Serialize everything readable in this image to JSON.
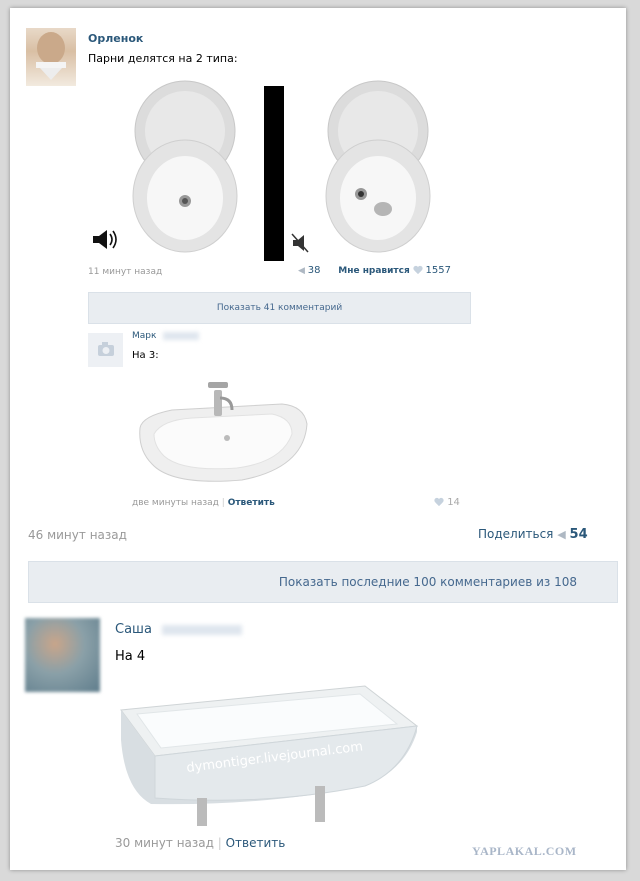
{
  "post": {
    "author": "Орленок",
    "text": "Парни делятся на 2 типа:",
    "time": "11 минут назад",
    "reposts": "38",
    "like_label": "Мне нравится",
    "likes": "1557"
  },
  "show_comments": "Показать 41 комментарий",
  "reply_marc": {
    "author": "Марк",
    "text": "На 3:",
    "time": "две минуты назад",
    "reply": "Ответить",
    "likes": "14"
  },
  "outer_post": {
    "time": "46 минут назад",
    "share_label": "Поделиться",
    "shares": "54"
  },
  "show_last": "Показать последние 100 комментариев из 108",
  "reply_sasha": {
    "author": "Саша",
    "text": "На 4",
    "watermark": "dymontiger.livejournal.com",
    "time": "30 минут назад",
    "reply": "Ответить"
  },
  "site_watermark": "YAPLAKAL.COM",
  "icons": {
    "sound_on": "speaker-on-icon",
    "sound_off": "speaker-muted-icon",
    "repost": "megaphone-icon",
    "like": "heart-icon"
  },
  "colors": {
    "link": "#2b587a",
    "bar_bg": "#e9edf1",
    "bar_text": "#45688e"
  }
}
